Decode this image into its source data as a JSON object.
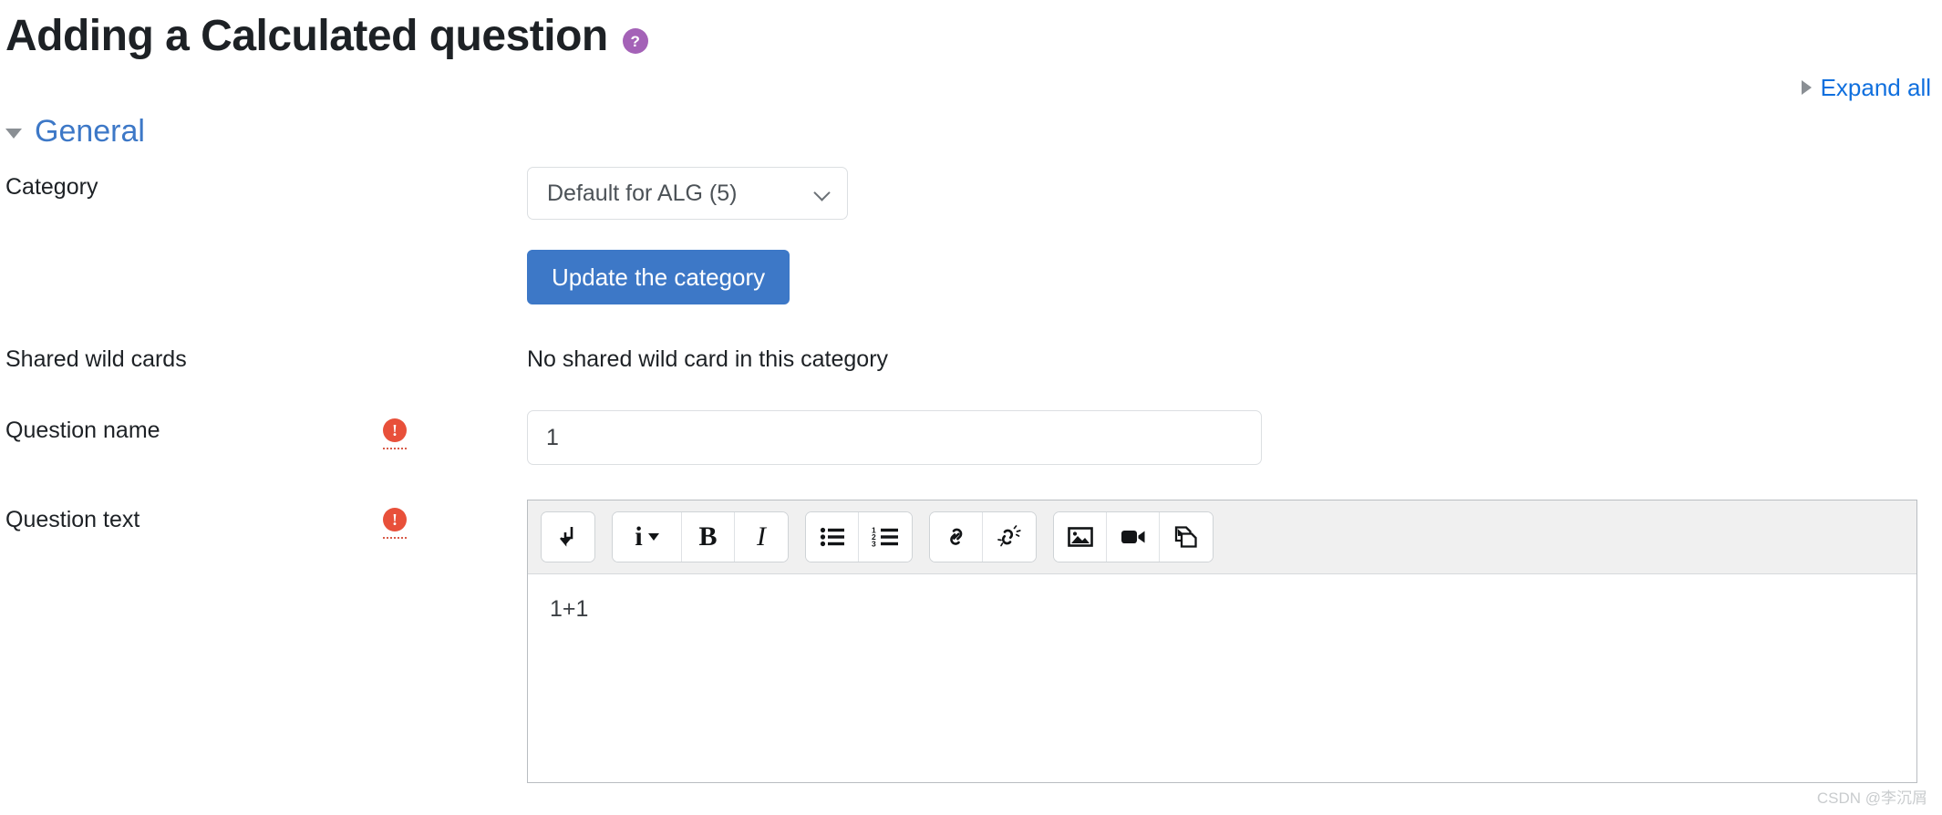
{
  "header": {
    "title": "Adding a Calculated question",
    "help_icon": "help-circle-icon",
    "help_glyph": "?"
  },
  "toolbar_top": {
    "expand_all_label": "Expand all",
    "expand_all_icon": "caret-right-icon"
  },
  "section": {
    "title": "General",
    "collapse_icon": "caret-down-icon",
    "expanded": true
  },
  "form": {
    "category": {
      "label": "Category",
      "selected": "Default for ALG (5)",
      "options": [
        "Default for ALG (5)"
      ],
      "chevron_icon": "chevron-down-icon"
    },
    "update_category": {
      "label": "Update the category"
    },
    "shared_wild_cards": {
      "label": "Shared wild cards",
      "value": "No shared wild card in this category"
    },
    "question_name": {
      "label": "Question name",
      "value": "1",
      "placeholder": "",
      "required_icon": "required-exclamation-icon",
      "required_glyph": "!"
    },
    "question_text": {
      "label": "Question text",
      "content": "1+1",
      "required_icon": "required-exclamation-icon",
      "required_glyph": "!"
    }
  },
  "editor_toolbar": {
    "groups": [
      {
        "name": "expand-group",
        "buttons": [
          {
            "name": "expand-toolbar-button",
            "icon": "arrow-down-hook-icon",
            "glyph": "⤵"
          }
        ]
      },
      {
        "name": "format-group",
        "buttons": [
          {
            "name": "paragraph-style-button",
            "icon": "info-style-dropdown-icon",
            "glyph": "i"
          },
          {
            "name": "bold-button",
            "icon": "bold-icon",
            "glyph": "B"
          },
          {
            "name": "italic-button",
            "icon": "italic-icon",
            "glyph": "I"
          }
        ]
      },
      {
        "name": "list-group",
        "buttons": [
          {
            "name": "bulleted-list-button",
            "icon": "bulleted-list-icon",
            "glyph": ""
          },
          {
            "name": "numbered-list-button",
            "icon": "numbered-list-icon",
            "glyph": ""
          }
        ]
      },
      {
        "name": "link-group",
        "buttons": [
          {
            "name": "insert-link-button",
            "icon": "link-chain-icon",
            "glyph": ""
          },
          {
            "name": "unlink-button",
            "icon": "broken-link-icon",
            "glyph": ""
          }
        ]
      },
      {
        "name": "media-group",
        "buttons": [
          {
            "name": "insert-image-button",
            "icon": "image-icon",
            "glyph": ""
          },
          {
            "name": "insert-video-button",
            "icon": "video-camera-icon",
            "glyph": ""
          },
          {
            "name": "manage-files-button",
            "icon": "manage-files-icon",
            "glyph": ""
          }
        ]
      }
    ]
  },
  "watermark": {
    "text": "CSDN @李沉屑"
  },
  "colors": {
    "accent_blue": "#3d78c7",
    "link_blue": "#0f6fde",
    "help_purple": "#a462b7",
    "required_red": "#e8503a",
    "toolbar_gray": "#f0f0f0"
  }
}
